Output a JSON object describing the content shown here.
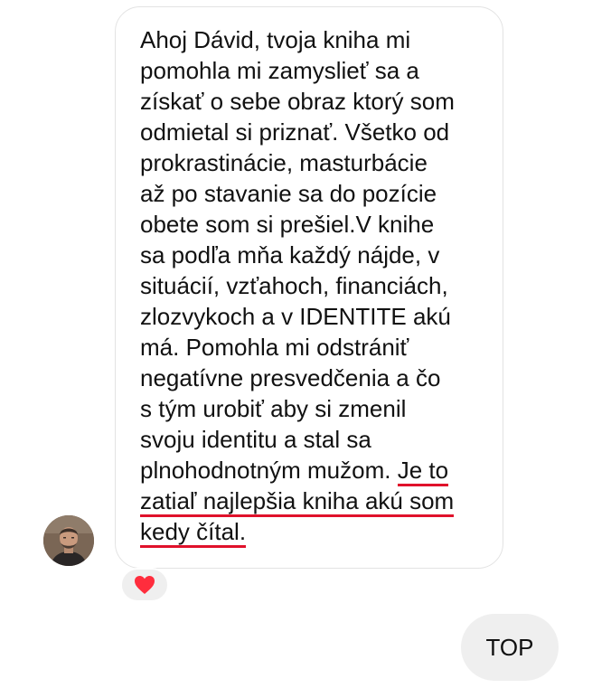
{
  "conversation": {
    "incoming_message": {
      "lines": [
        "Ahoj Dávid, tvoja kniha mi",
        "pomohla mi zamyslieť sa a",
        "získať o sebe obraz ktorý som",
        "odmietal si priznať. Všetko od",
        "prokrastinácie, masturbácie",
        "až po stavanie sa do pozície",
        "obete som si prešiel.V knihe",
        "sa podľa mňa každý nájde, v",
        "situácií, vzťahoch, financiách,",
        "zlozvykoch a v IDENTITE akú",
        "má. Pomohla mi odstrániť",
        "negatívne presvedčenia a čo",
        "s tým urobiť aby si zmenil",
        "svoju identitu a stal sa"
      ],
      "line15_plain": "plnohodnotným mužom. ",
      "line15_underlined": "Je to",
      "line16_underlined": "zatiaľ najlepšia kniha akú som",
      "line17_underlined": "kedy čítal."
    },
    "reaction": {
      "icon": "heart-icon",
      "color": "#ff2d3d"
    },
    "outgoing_message": {
      "text": "TOP"
    },
    "colors": {
      "underline": "#e0112b",
      "bubble_gray": "#efefef"
    }
  }
}
